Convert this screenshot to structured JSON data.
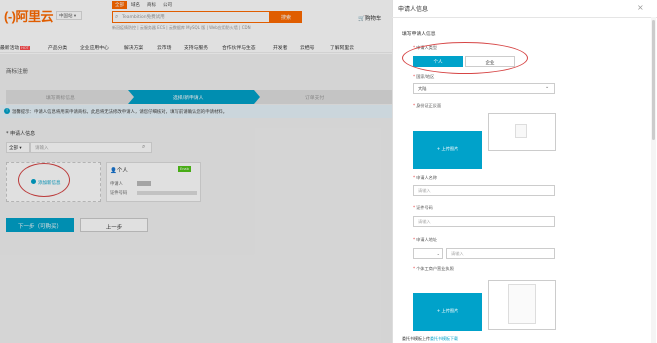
{
  "header": {
    "logo": "(-)阿里云",
    "region": "中国站 ▾",
    "search_tabs": [
      "全部",
      "域名",
      "商标",
      "公司"
    ],
    "search_placeholder": "Teambition免费试用",
    "search_button": "搜索",
    "hot_words": "新冠疫情防控 | 云服务器 ECS | 云数据库 MySQL 版 | Web应用防火墙 | CDN",
    "cart": "购物车"
  },
  "nav": [
    "最新活动",
    "产品分类",
    "企业应用中心",
    "解决方案",
    "云市场",
    "支持与服务",
    "合作伙伴与生态",
    "开发者",
    "云栖号",
    "了解阿里云"
  ],
  "nav_hot_badge": "HOT",
  "page": {
    "title": "商标注册",
    "steps": [
      "填写商标信息",
      "选择/新申请人",
      "订单支付"
    ],
    "notice": "温馨提示：申请人信息将用来申请商标，此后将无法修改申请人，请您仔细核对，填写前请确认您的申请材料。",
    "applicant_label": "* 申请人信息",
    "type_select": "全部 ▾",
    "name_placeholder": "请输入",
    "add_new": "添加新信息",
    "person_card": {
      "type": "个人",
      "badge": "Enab",
      "label1": "申请人",
      "label2": "证件号码"
    },
    "next_button": "下一步（可购买）",
    "prev_button": "上一步"
  },
  "panel": {
    "title": "申请人信息",
    "form_title": "填写申请人信息",
    "type_label": "申请人类型",
    "type_personal": "个人",
    "type_company": "企业",
    "region_label": "国家/地区",
    "region_value": "大陆",
    "id_upload_label": "身份证正反面",
    "upload_button": "+ 上传图片",
    "name_label": "申请人名称",
    "name_placeholder": "请输入",
    "id_label": "证件号码",
    "id_placeholder": "请输入",
    "address_label": "申请人地址",
    "address_select": "",
    "address_placeholder": "请输入",
    "license_label": "个体工商户营业执照",
    "footer_text": "委托书模板上传",
    "footer_link": "委托书模板下载"
  }
}
